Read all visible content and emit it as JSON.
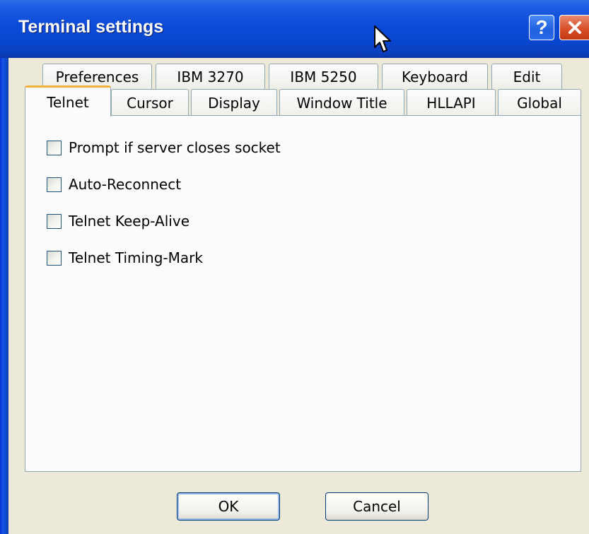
{
  "window": {
    "title": "Terminal settings",
    "help_button": "?",
    "close_button": "✕"
  },
  "tabs": {
    "back_row": [
      "Preferences",
      "IBM 3270",
      "IBM 5250",
      "Keyboard",
      "Edit"
    ],
    "front_row": [
      "Telnet",
      "Cursor",
      "Display",
      "Window Title",
      "HLLAPI",
      "Global"
    ],
    "active": "Telnet"
  },
  "options": [
    {
      "label": "Prompt if server closes socket",
      "checked": false
    },
    {
      "label": "Auto-Reconnect",
      "checked": false
    },
    {
      "label": "Telnet Keep-Alive",
      "checked": false
    },
    {
      "label": "Telnet Timing-Mark",
      "checked": false
    }
  ],
  "buttons": {
    "ok": "OK",
    "cancel": "Cancel"
  },
  "colors": {
    "titlebar": "#0a4ad6",
    "active_tab_accent": "#f4b03d",
    "dialog_bg": "#ece9d8",
    "close_button": "#d9502b"
  }
}
